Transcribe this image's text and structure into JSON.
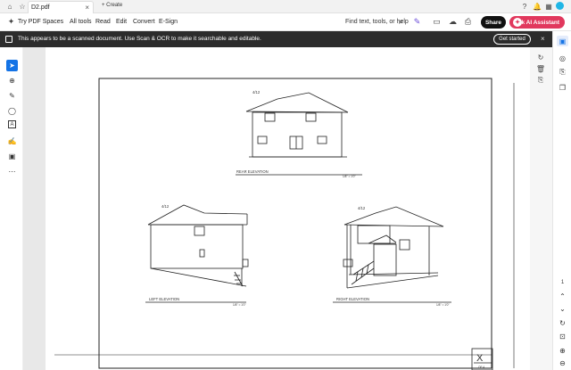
{
  "tabs": {
    "home_icon": "home-icon",
    "document_tab": "D2.pdf",
    "create_label": "Create"
  },
  "toolbar": {
    "try_spaces": "Try PDF Spaces",
    "menu": [
      "All tools",
      "Read",
      "Edit",
      "Convert",
      "E-Sign"
    ],
    "search_hint": "Find text, tools, or help",
    "share": "Share",
    "ai_assistant": "Ask AI Assistant"
  },
  "banner": {
    "message": "This appears to be a scanned document. Use Scan & OCR to make it searchable and editable.",
    "button": "Get started"
  },
  "drawing": {
    "rear_label": "REAR ELEVATION",
    "rear_scale": "1/8\" = 1'0\"",
    "left_label": "LEFT ELEVATION",
    "left_scale": "1/8\" = 1'0\"",
    "right_label": "RIGHT ELEVATION",
    "right_scale": "1/8\" = 1'0\"",
    "pitch_rear": "4/12",
    "pitch_left": "4/12",
    "pitch_right": "4/12",
    "title_block_mark": "X",
    "title_block_sub": "OF 4"
  },
  "page_nav": {
    "current": "1",
    "total": "1"
  },
  "colors": {
    "accent": "#1473e6",
    "ai": "#e1385d",
    "banner": "#2c2c2c"
  }
}
